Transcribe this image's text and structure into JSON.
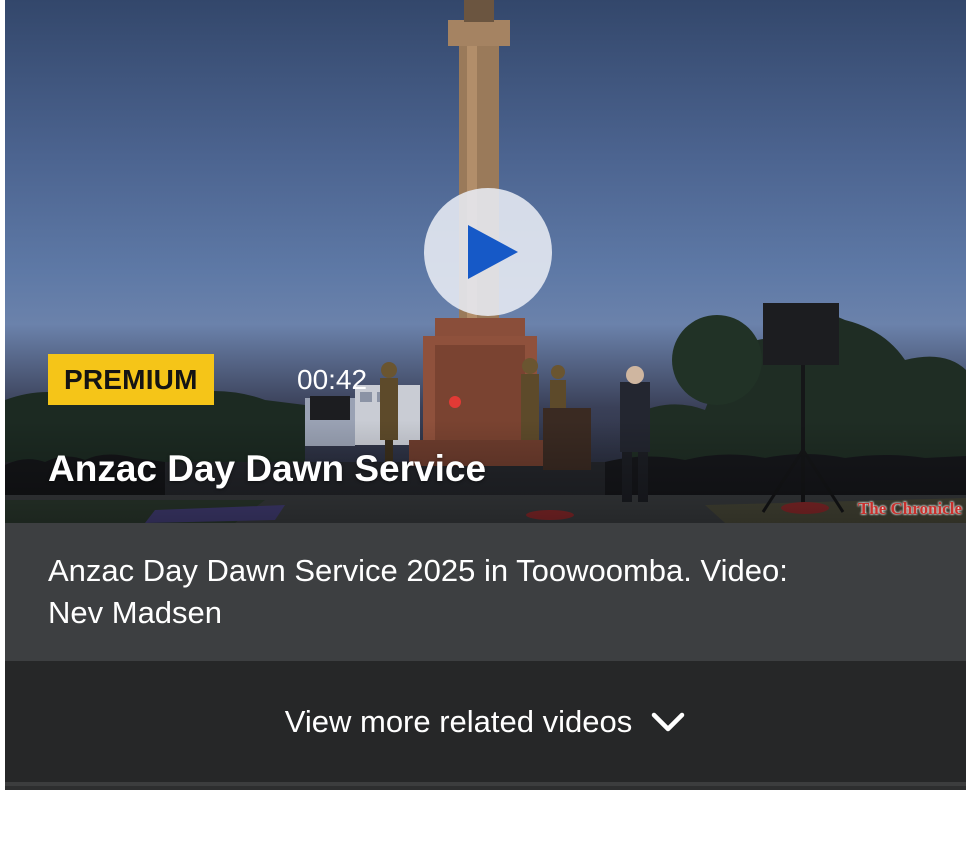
{
  "video": {
    "badge": "PREMIUM",
    "duration": "00:42",
    "title": "Anzac Day Dawn Service",
    "watermark": "The Chronicle",
    "play_icon": "play-icon",
    "colors": {
      "badge_bg": "#f5c518",
      "play_triangle": "#1659c7"
    }
  },
  "caption": {
    "text": "Anzac Day Dawn Service 2025 in Toowoomba. Video: Nev Madsen"
  },
  "related": {
    "label": "View more related videos",
    "icon": "chevron-down-icon"
  }
}
